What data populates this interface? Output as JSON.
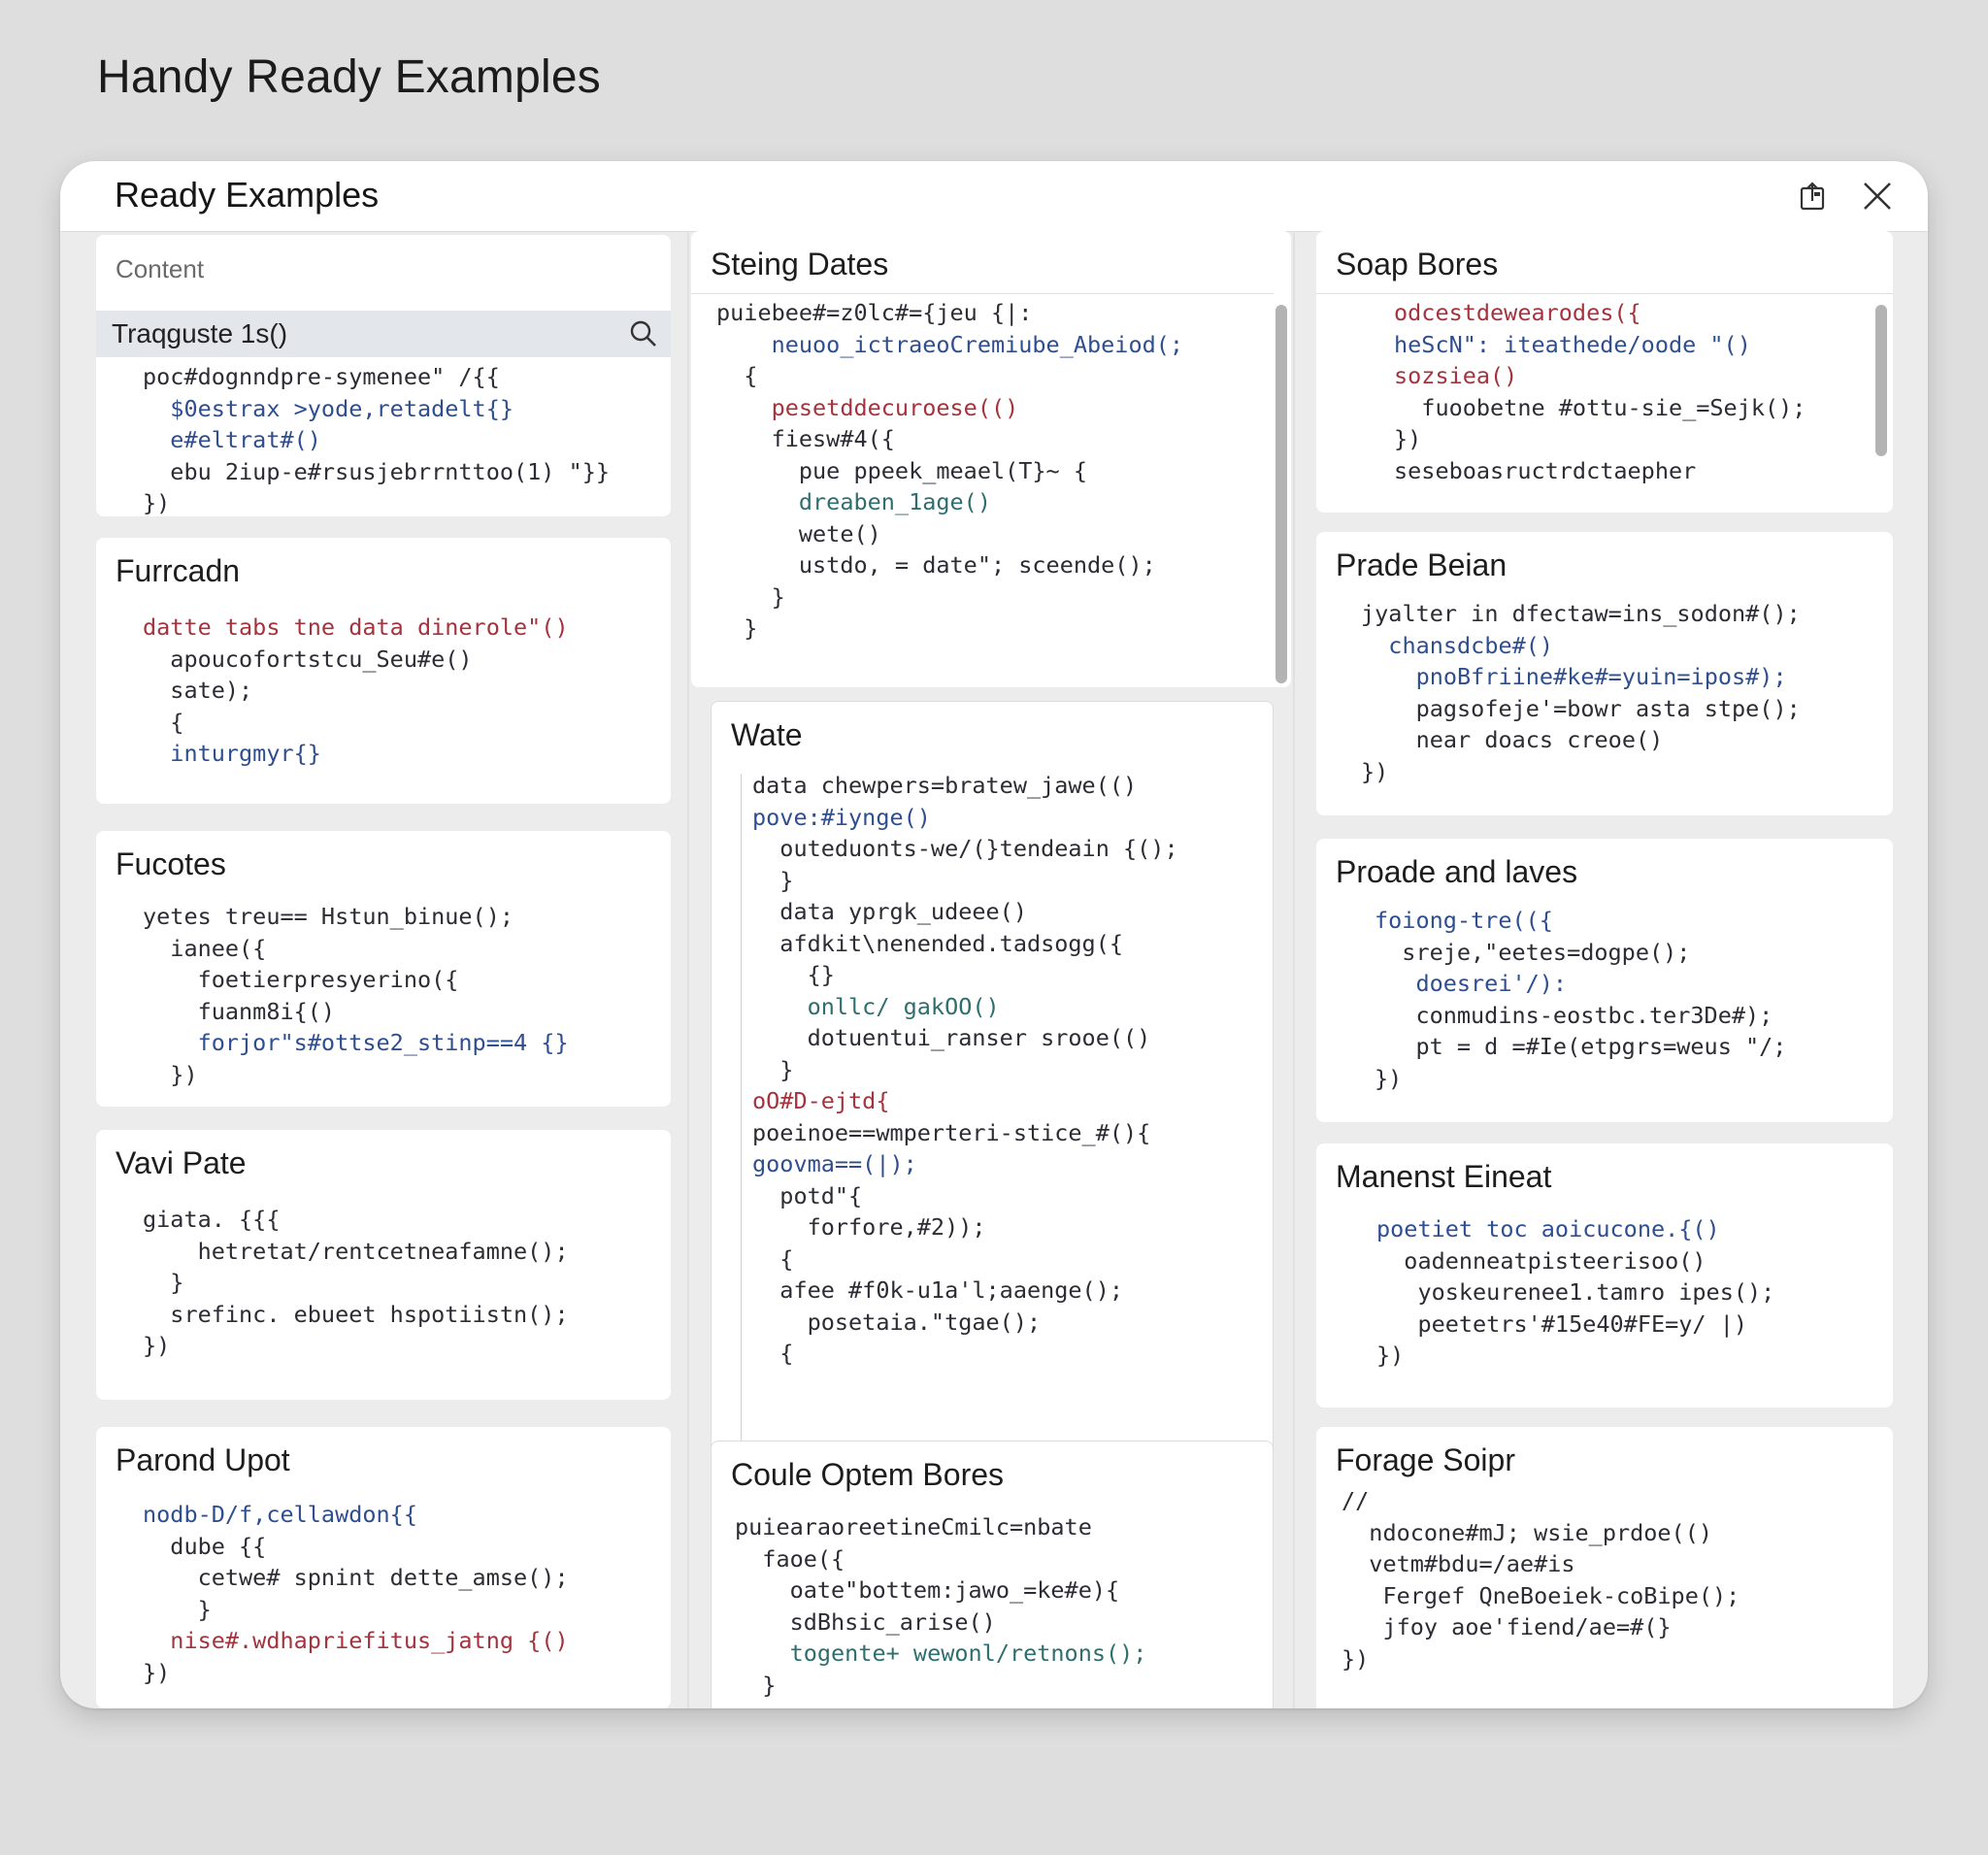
{
  "page": {
    "title": "Handy Ready Examples"
  },
  "dialog": {
    "title": "Ready Examples",
    "header_icons": [
      "export-icon",
      "close-icon"
    ]
  },
  "left_column": {
    "content_label": "Content",
    "search": {
      "value": "Traqguste 1s()"
    },
    "search_snippet": [
      "poc#dognndpre-symenee\" /{{",
      "  $0estrax >yode,retadelt{}",
      "  e#eltrat#()",
      "  ebu 2iup-e#rsusjebrrnttoo(1) \"}}",
      "})"
    ],
    "cards": [
      {
        "title": "Furrcadn",
        "code": [
          "datte tabs tne data dinerole\"()",
          "  apoucofortstcu_Seu#e()",
          "  sate);",
          "  {",
          "  inturgmyr{}"
        ]
      },
      {
        "title": "Fucotes",
        "code": [
          "yetes treu== Hstun_binue();",
          "  ianee({",
          "    foetierpresyerino({",
          "    fuanm8i{()",
          "    forjor\"s#ottse2_stinp==4 {}",
          "  })"
        ]
      },
      {
        "title": "Vavi Pate",
        "code": [
          "giata. {{{",
          "    hetretat/rentcetneafamne();",
          "  }",
          "  srefinc. ebueet hspotiistn();",
          "})"
        ]
      },
      {
        "title": "Parond Upot",
        "code": [
          "nodb-D/f,cellawdon{{",
          "  dube {{",
          "    cetwe# spnint dette_amse();",
          "    }",
          "  nise#.wdhapriefitus_jatng {()",
          "})"
        ]
      }
    ]
  },
  "middle_column": {
    "cards": [
      {
        "title": "Steing Dates",
        "code": [
          "puiebee#=z0lc#={jeu {|:",
          "    neuoo_ictraeoCremiube_Abeiod(;",
          "  {",
          "    pesetddecuroese(()",
          "    fiesw#4({",
          "      pue ppeek_meael(T}~ {",
          "      dreaben_1age()",
          "      wete()",
          "      ustdo, = date\"; sceende();",
          "    }",
          "  }"
        ]
      },
      {
        "title": "Wate",
        "code": [
          "data chewpers=bratew_jawe(()",
          "pove:#iynge()",
          "  outeduonts-we/(}tendeain {();",
          "  }",
          "  data yprgk_udeee()",
          "  afdkit\\nenended.tadsogg({",
          "    {}",
          "    onllc/ gakOO()",
          "    dotuentui_ranser srooe(()",
          "  }",
          "",
          "oO#D-ejtd{",
          "poeinoe==wmperteri-stice_#(){",
          "goovma==(|);",
          "  potd\"{",
          "    forfore,#2));",
          "  {",
          "  afee #f0k-u1a'l;aaenge();",
          "    posetaia.\"tgae();",
          "  {"
        ]
      },
      {
        "title": "Coule Optem Bores",
        "code": [
          "puiearaoreetineCmilc=nbate",
          "  faoe({",
          "    oate\"bottem:jawo_=ke#e){",
          "    sdBhsic_arise()",
          "    togente+ wewonl/retnons();",
          "  }"
        ]
      }
    ]
  },
  "right_column": {
    "cards": [
      {
        "title": "Soap Bores",
        "code": [
          "odcestdewearodes({",
          "heScN\": iteathede/oode \"()",
          "sozsiea()",
          "  fuoobetne #ottu-sie_=Sejk();",
          "})",
          "seseboasructrdctaepher"
        ]
      },
      {
        "title": "Prade Beian",
        "code": [
          "jyalter in dfectaw=ins_sodon#();",
          "  chansdcbe#()",
          "    pnoBfriine#ke#=yuin=ipos#);",
          "    pagsofeje'=bowr asta stpe();",
          "    near doacs creoe()",
          "})"
        ]
      },
      {
        "title": "Proade and laves",
        "code": [
          "foiong-tre(({",
          "  sreje,\"eetes=dogpe();",
          "   doesrei'/):",
          "   conmudins-eostbc.ter3De#);",
          "   pt = d =#Ie(etpgrs=weus \"/;",
          "})"
        ]
      },
      {
        "title": "Manenst Eineat",
        "code": [
          "poetiet toc aoicucone.{()",
          "  oadenneatpisteerisoo()",
          "   yoskeurenee1.tamro ipes();",
          "   peetetrs'#15e40#FE=y/ |)",
          "})"
        ]
      },
      {
        "title": "Forage Soipr",
        "code": [
          "//",
          "  ndocone#mJ; wsie_prdoe(()",
          "  vetm#bdu=/ae#is",
          "   Fergef QneBoeiek-coBipe();",
          "   jfoy aoe'fiend/ae=#(}",
          "})"
        ]
      }
    ]
  }
}
